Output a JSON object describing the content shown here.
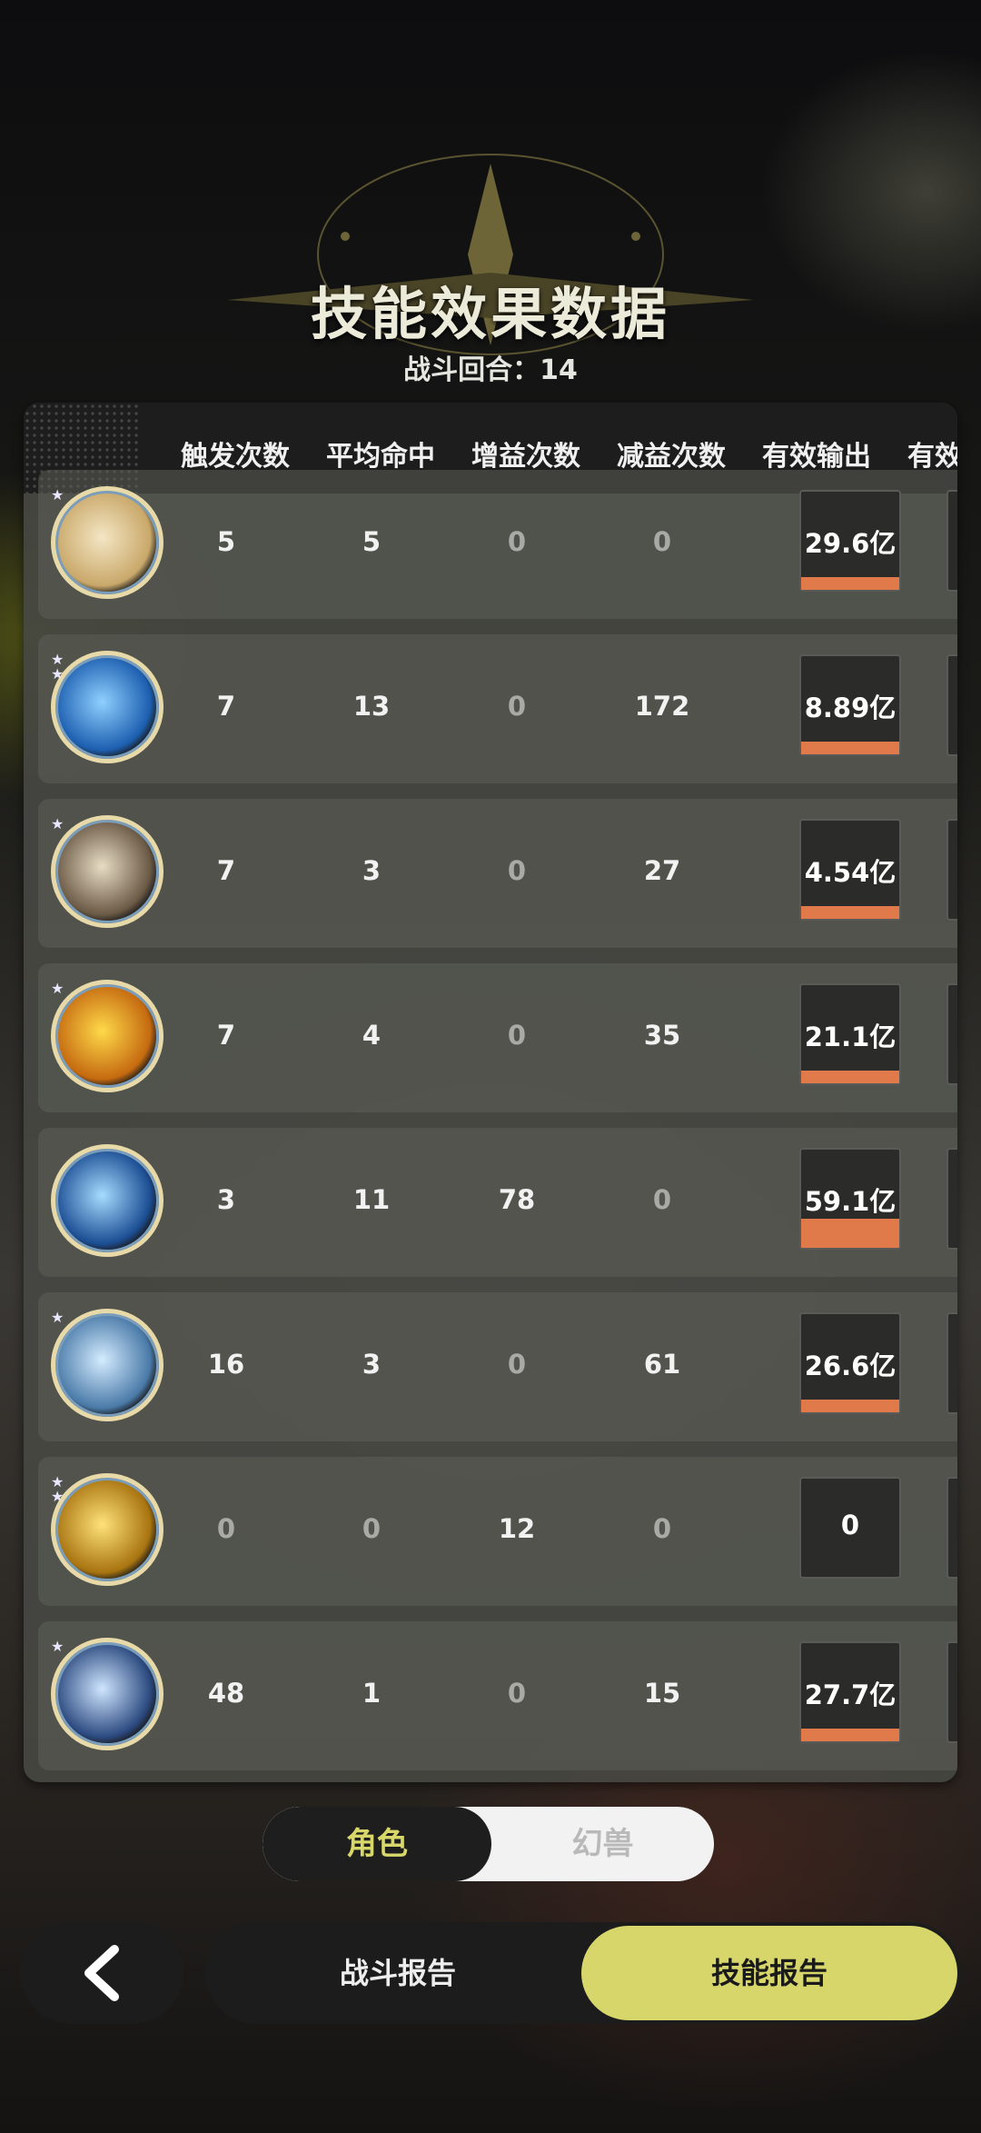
{
  "header": {
    "title": "技能效果数据",
    "subtitle": "战斗回合：14"
  },
  "columns": [
    "触发次数",
    "平均命中",
    "增益次数",
    "减益次数",
    "有效输出",
    "有效"
  ],
  "rows": [
    {
      "icon": "wing-slash-icon",
      "colors": [
        "#f4e6c4",
        "#c9a86a"
      ],
      "trigger": "5",
      "hit": "5",
      "buff": "0",
      "debuff": "0",
      "output": "29.6亿",
      "output_fraction": 1.0,
      "stars": 1
    },
    {
      "icon": "blue-vortex-icon",
      "colors": [
        "#8fd0ff",
        "#1d5fb0"
      ],
      "trigger": "7",
      "hit": "13",
      "buff": "0",
      "debuff": "172",
      "output": "8.89亿",
      "output_fraction": 0.2,
      "stars": 2
    },
    {
      "icon": "skull-burst-icon",
      "colors": [
        "#e8dcc4",
        "#6b5a46"
      ],
      "trigger": "7",
      "hit": "3",
      "buff": "0",
      "debuff": "27",
      "output": "4.54亿",
      "output_fraction": 0.1,
      "stars": 1
    },
    {
      "icon": "fire-burst-icon",
      "colors": [
        "#ffd94a",
        "#c56a10"
      ],
      "trigger": "7",
      "hit": "4",
      "buff": "0",
      "debuff": "35",
      "output": "21.1亿",
      "output_fraction": 0.7,
      "stars": 1
    },
    {
      "icon": "water-ring-icon",
      "colors": [
        "#a6dcff",
        "#1c4e94"
      ],
      "trigger": "3",
      "hit": "11",
      "buff": "78",
      "debuff": "0",
      "output": "59.1亿",
      "output_fraction": 2.0,
      "stars": 0
    },
    {
      "icon": "ice-shield-icon",
      "colors": [
        "#d4ecff",
        "#4a7aa8"
      ],
      "trigger": "16",
      "hit": "3",
      "buff": "0",
      "debuff": "61",
      "output": "26.6亿",
      "output_fraction": 0.9,
      "stars": 1
    },
    {
      "icon": "golden-crown-icon",
      "colors": [
        "#ffe27a",
        "#a87410"
      ],
      "trigger": "0",
      "hit": "0",
      "buff": "12",
      "debuff": "0",
      "output": "0",
      "output_fraction": 0,
      "stars": 2
    },
    {
      "icon": "crystal-shard-icon",
      "colors": [
        "#cfe6ff",
        "#2c4a80"
      ],
      "trigger": "48",
      "hit": "1",
      "buff": "0",
      "debuff": "15",
      "output": "27.7亿",
      "output_fraction": 0.95,
      "stars": 1
    }
  ],
  "toggle": {
    "active": "角色",
    "inactive": "幻兽"
  },
  "bottom": {
    "tab_battle": "战斗报告",
    "tab_skill": "技能报告"
  },
  "accent": "#d7d66b",
  "bar_color": "#e07a4a"
}
